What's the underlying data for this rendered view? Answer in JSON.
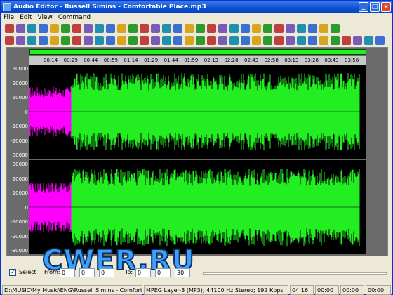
{
  "window": {
    "title": "Audio Editor - Russell Simins - Comfortable Place.mp3"
  },
  "menu": [
    "File",
    "Edit",
    "View",
    "Command"
  ],
  "timeline": {
    "ticks": [
      "00:14",
      "00:29",
      "00:44",
      "00:59",
      "01:14",
      "01:29",
      "01:44",
      "01:59",
      "02:13",
      "02:28",
      "02:43",
      "02:58",
      "03:13",
      "03:28",
      "03:43",
      "03:58"
    ]
  },
  "axis": {
    "labels": [
      "30000",
      "20000",
      "10000",
      "0",
      "-10000",
      "-20000",
      "-30000"
    ]
  },
  "controls": {
    "select_label": "Select",
    "from_label": "From:",
    "to_label": "To:",
    "from": [
      "0",
      "0",
      "0",
      "0"
    ],
    "to": [
      "0",
      "0",
      "30",
      "0"
    ]
  },
  "status": {
    "path": "D:\\MUSIC\\My Music\\ENG\\Russell Simins - Comfortable Place.mp3",
    "format": "MPEG Layer-3 (MP3); 44100 Hz Stereo; 192 Kbps",
    "duration": "04:16",
    "pos1": "00:00",
    "pos2": "00:00",
    "pos3": "00:00"
  },
  "watermark": "CWER.RU",
  "colors": {
    "waveform": "#22ee22",
    "selection": "#ff00ff",
    "background": "#000000"
  }
}
